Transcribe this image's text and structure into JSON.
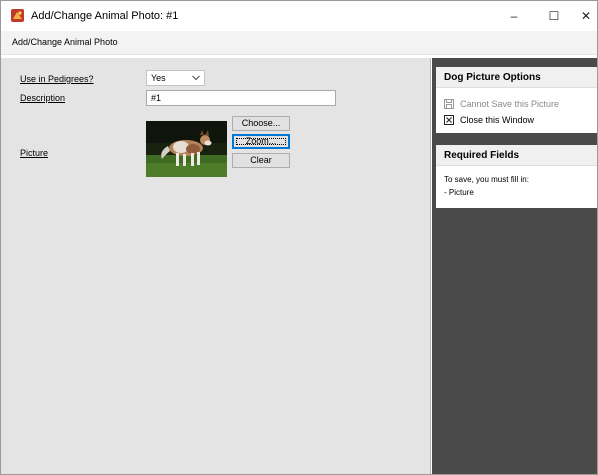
{
  "window": {
    "title": "Add/Change Animal Photo: #1",
    "app_icon": "dog-paw-app-icon",
    "controls": {
      "minimize": "–",
      "maximize": "☐",
      "close": "✕"
    }
  },
  "menubar": {
    "title": "Add/Change Animal Photo"
  },
  "form": {
    "use_in_pedigrees": {
      "label": "Use in Pedigrees?",
      "value": "Yes"
    },
    "description": {
      "label": "Description",
      "value": "#1"
    },
    "picture": {
      "label": "Picture",
      "thumbnail": "dog-photo-thumbnail",
      "buttons": {
        "choose": "Choose...",
        "zoom": "Zoom...",
        "clear": "Clear"
      }
    }
  },
  "sidebar": {
    "options_panel": {
      "title": "Dog Picture Options",
      "items": [
        {
          "label": "Cannot Save this Picture",
          "icon": "save-disk-icon",
          "enabled": false
        },
        {
          "label": "Close this Window",
          "icon": "close-box-icon",
          "enabled": true
        }
      ]
    },
    "required_panel": {
      "title": "Required Fields",
      "lines": [
        "To save, you must fill in:",
        "- Picture"
      ]
    }
  },
  "colors": {
    "form_background": "#e4e4e4",
    "sidebar_background": "#4a4a4a",
    "focus_border": "#0078d7",
    "disabled_text": "#8a8a8a"
  }
}
